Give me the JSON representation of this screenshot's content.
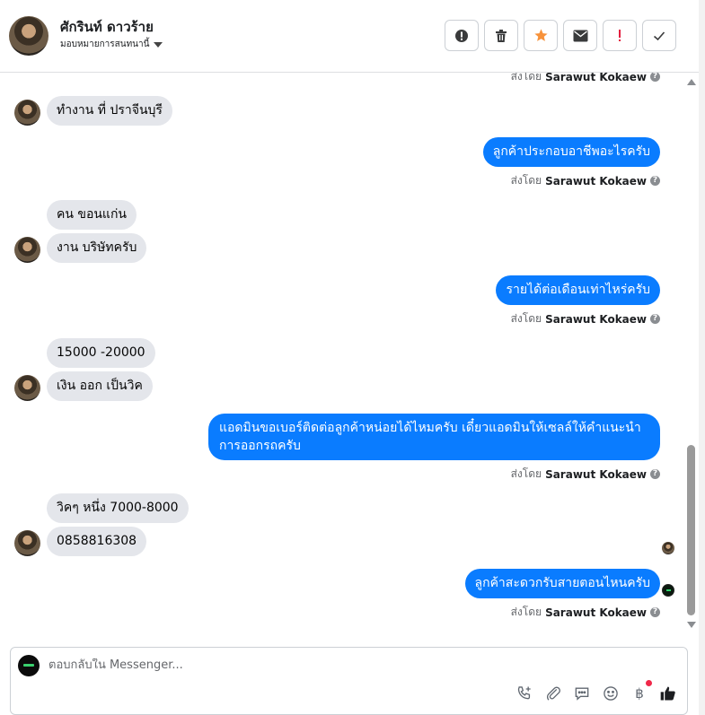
{
  "header": {
    "contact_name": "ศักรินท์ ดาวร้าย",
    "assign_label": "มอบหมายการสนทนานี้",
    "actions": [
      {
        "name": "spam-button",
        "icon": "alert-circle-icon"
      },
      {
        "name": "delete-button",
        "icon": "trash-icon"
      },
      {
        "name": "star-button",
        "icon": "star-icon",
        "color": "#f7923b"
      },
      {
        "name": "mark-unread-button",
        "icon": "envelope-icon"
      },
      {
        "name": "follow-up-button",
        "icon": "exclamation-icon",
        "color": "#e41e3f"
      },
      {
        "name": "mark-done-button",
        "icon": "checkmark-icon"
      }
    ]
  },
  "sent_by_prefix": "ส่งโดย",
  "agent_name": "Sarawut Kokaew",
  "messages": [
    {
      "dir": "out-meta",
      "text": ""
    },
    {
      "dir": "in",
      "text": "ทำงาน ที่ ปราจีนบุรี"
    },
    {
      "dir": "out",
      "text": "ลูกค้าประกอบอาชีพอะไรครับ"
    },
    {
      "dir": "in",
      "text": "คน ขอนแก่น"
    },
    {
      "dir": "in",
      "text": "งาน บริษัทครับ"
    },
    {
      "dir": "out",
      "text": "รายได้ต่อเดือนเท่าไหร่ครับ"
    },
    {
      "dir": "in",
      "text": "15000 -20000"
    },
    {
      "dir": "in",
      "text": "เงิน ออก เป็นวิค"
    },
    {
      "dir": "out",
      "text": "แอดมินขอเบอร์ติดต่อลูกค้าหน่อยได้ไหมครับ เดี๋ยวแอดมินให้เซลล์ให้คำแนะนำการออกรถครับ"
    },
    {
      "dir": "in",
      "text": "วิคๆ หนึ่ง 7000-8000"
    },
    {
      "dir": "in",
      "text": "0858816308"
    },
    {
      "dir": "out",
      "text": "ลูกค้าสะดวกรับสายตอนไหนครับ"
    }
  ],
  "composer": {
    "placeholder": "ตอบกลับใน Messenger...",
    "currency_symbol": "฿",
    "tools": [
      "phone-add-icon",
      "paperclip-icon",
      "saved-replies-icon",
      "emoji-icon",
      "baht-icon",
      "thumbs-up-icon"
    ]
  },
  "colors": {
    "outgoing_bubble": "#0a7cff",
    "incoming_bubble": "#e4e6eb"
  }
}
